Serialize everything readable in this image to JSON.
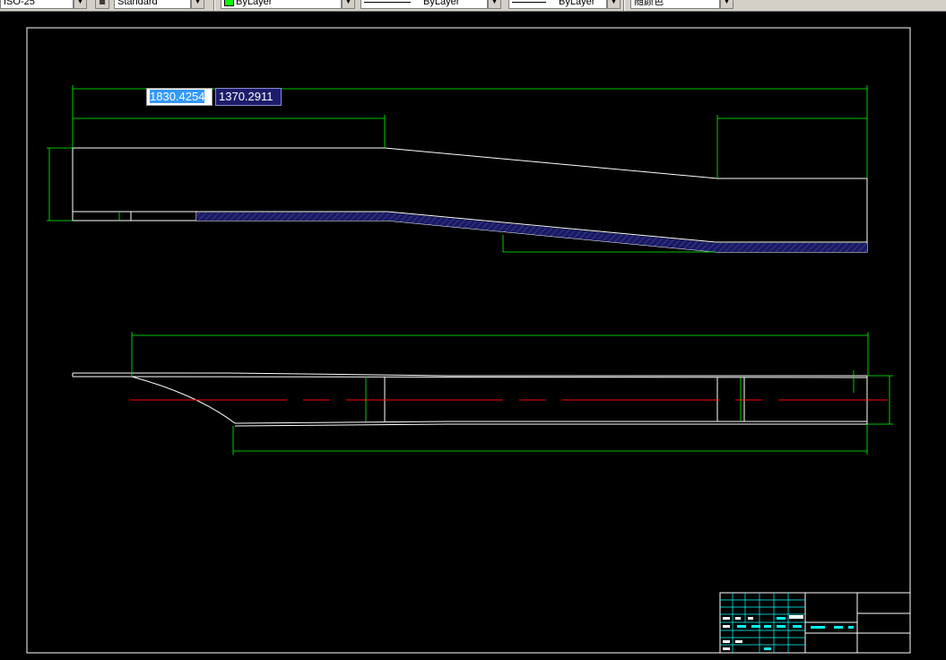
{
  "toolbar": {
    "dim_style_value": "ISO-25",
    "text_style_value": "Standard",
    "color_value": "ByLayer",
    "linetype_value": "ByLayer",
    "lineweight_value": "ByLayer",
    "plotstyle_value": "随颜色"
  },
  "coordinate_input": {
    "x_value": "1830.4254",
    "y_value": "1370.2911"
  },
  "drawing": {
    "background_color": "#000000",
    "geometry_color": "#ffffff",
    "dimension_color": "#00ff00",
    "centerline_color": "#ff0000",
    "hatch_color": "#2a2a8c",
    "title_block_color": "#00ffff"
  }
}
